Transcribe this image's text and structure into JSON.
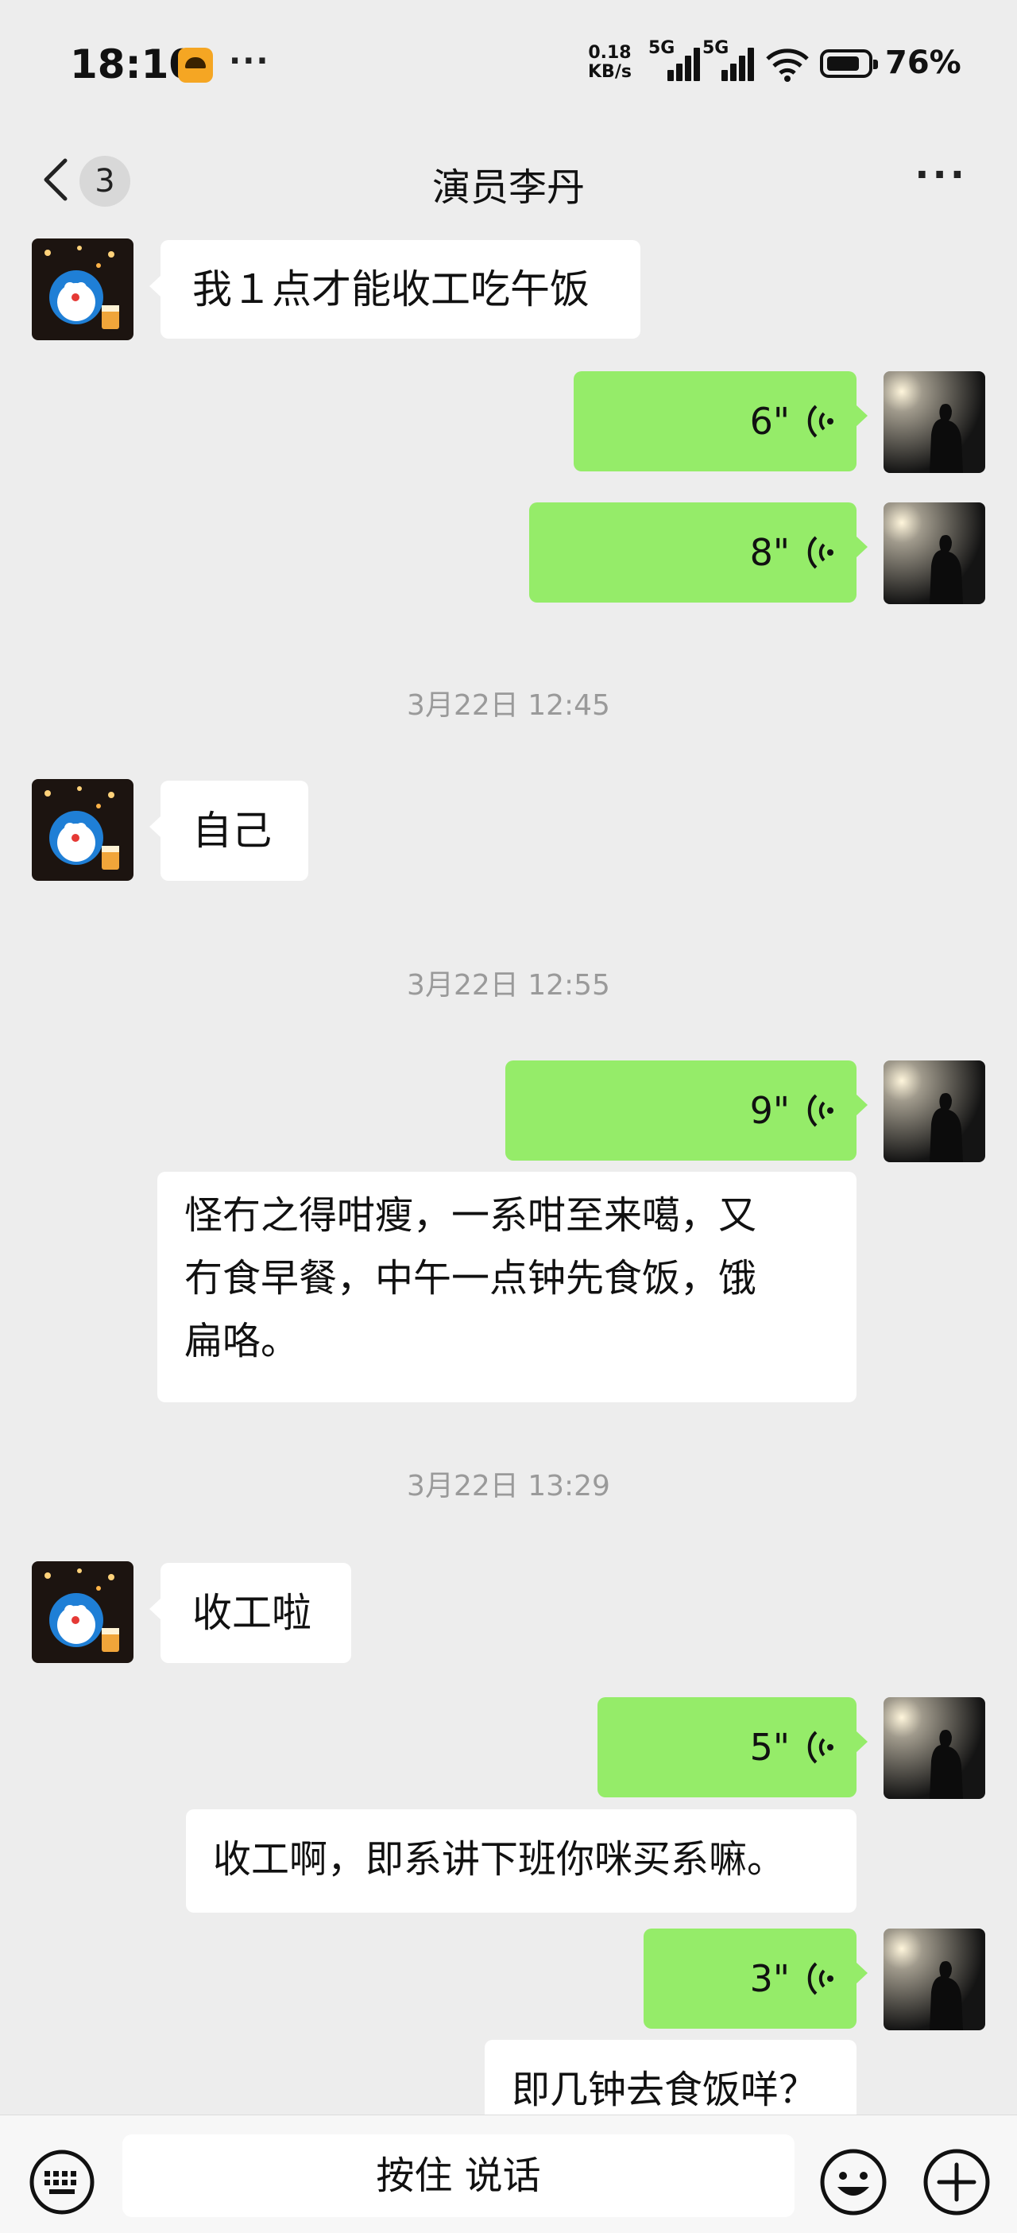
{
  "status_bar": {
    "time": "18:10",
    "net_speed_value": "0.18",
    "net_speed_unit": "KB/s",
    "sim1_label": "5G",
    "sim2_label": "5G",
    "battery": "76%"
  },
  "nav": {
    "unread_count": "3",
    "title": "演员李丹"
  },
  "messages": [
    {
      "side": "in",
      "kind": "text",
      "text": "我１点才能收工吃午饭"
    },
    {
      "side": "out",
      "kind": "voice",
      "duration": "6\""
    },
    {
      "side": "out",
      "kind": "voice",
      "duration": "8\""
    },
    {
      "kind": "timestamp",
      "text": "3月22日 12:45"
    },
    {
      "side": "in",
      "kind": "text",
      "text": "自己"
    },
    {
      "kind": "timestamp",
      "text": "3月22日 12:55"
    },
    {
      "side": "out",
      "kind": "voice",
      "duration": "9\""
    },
    {
      "side": "transcript",
      "kind": "text",
      "lines": [
        "怪冇之得咁瘦，一系咁至来噶，又",
        "冇食早餐，中午一点钟先食饭，饿",
        "扁咯。"
      ]
    },
    {
      "kind": "timestamp",
      "text": "3月22日 13:29"
    },
    {
      "side": "in",
      "kind": "text",
      "text": "收工啦"
    },
    {
      "side": "out",
      "kind": "voice",
      "duration": "5\""
    },
    {
      "side": "transcript",
      "kind": "text",
      "text": "收工啊，即系讲下班你咪买系嘛。"
    },
    {
      "side": "out",
      "kind": "voice",
      "duration": "3\""
    },
    {
      "side": "transcript",
      "kind": "text",
      "text": "即几钟去食饭咩？"
    }
  ],
  "input_bar": {
    "hold_to_talk": "按住 说话"
  },
  "colors": {
    "background": "#ededed",
    "outgoing_bubble": "#95ec69",
    "incoming_bubble": "#ffffff",
    "timestamp_text": "#9a9a9a"
  },
  "icons": [
    "back-chevron-icon",
    "more-icon",
    "voice-wave-icon",
    "keyboard-icon",
    "emoji-icon",
    "plus-icon"
  ]
}
